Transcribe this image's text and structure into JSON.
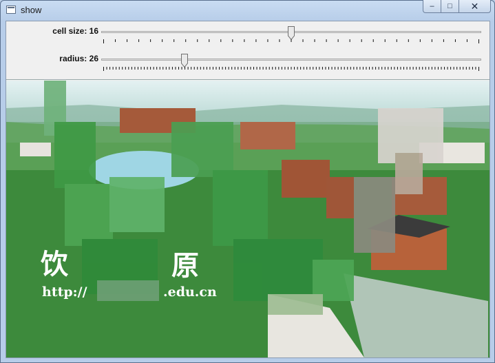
{
  "window": {
    "title": "show",
    "minimize_glyph": "–",
    "maximize_glyph": "□",
    "close_glyph": "✕"
  },
  "controls": {
    "cell_size": {
      "label": "cell size: 16",
      "value": 16,
      "max": 32,
      "ticks": 33
    },
    "radius": {
      "label": "radius: 26",
      "value": 26,
      "max": 120,
      "ticks": 121
    }
  },
  "image": {
    "watermark_text": "http://",
    "watermark_domain": ".edu.cn",
    "watermark_big_1": "饮",
    "watermark_big_2": "原",
    "colors": {
      "sky": "#cfe6e8",
      "lake": "#8fd0e0",
      "grass": "#3e9a3a",
      "building": "#a85a3a",
      "roof": "#7a3a2a"
    }
  }
}
